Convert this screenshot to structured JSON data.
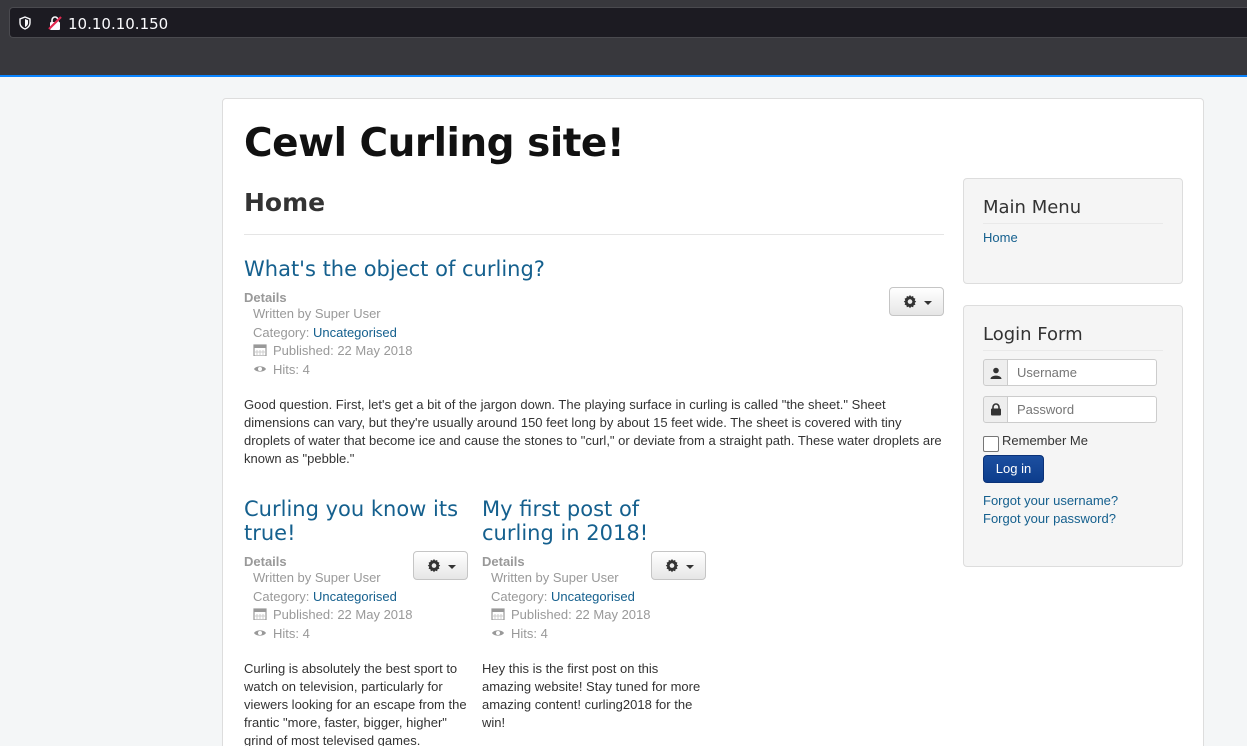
{
  "browser": {
    "url": "10.10.10.150"
  },
  "site": {
    "title": "Cewl Curling site!"
  },
  "main": {
    "page_heading": "Home",
    "details_label": "Details",
    "articles": [
      {
        "title": "What's the object of curling?",
        "author": "Written by Super User",
        "category_prefix": "Category: ",
        "category": "Uncategorised",
        "published": "Published: 22 May 2018",
        "hits": "Hits: 4",
        "body": "Good question. First, let's get a bit of the jargon down. The playing surface in curling is called \"the sheet.\" Sheet dimensions can vary, but they're usually around 150 feet long by about 15 feet wide. The sheet is covered with tiny droplets of water that become ice and cause the stones to \"curl,\" or deviate from a straight path. These water droplets are known as \"pebble.\""
      },
      {
        "title": "Curling you know its true!",
        "author": "Written by Super User",
        "category_prefix": "Category: ",
        "category": "Uncategorised",
        "published": "Published: 22 May 2018",
        "hits": "Hits: 4",
        "body": "Curling is absolutely the best sport to watch on television, particularly for viewers looking for an escape from the frantic \"more, faster, bigger, higher\" grind of most televised games."
      },
      {
        "title": "My first post of curling in 2018!",
        "author": "Written by Super User",
        "category_prefix": "Category: ",
        "category": "Uncategorised",
        "published": "Published: 22 May 2018",
        "hits": "Hits: 4",
        "body": "Hey this is the first post on this amazing website! Stay tuned for more amazing content! curling2018 for the win!"
      }
    ]
  },
  "sidebar": {
    "main_menu": {
      "title": "Main Menu",
      "items": [
        "Home"
      ]
    },
    "login": {
      "title": "Login Form",
      "username_placeholder": "Username",
      "password_placeholder": "Password",
      "remember_label": "Remember Me",
      "login_button": "Log in",
      "forgot_username": "Forgot your username?",
      "forgot_password": "Forgot your password?"
    }
  },
  "colors": {
    "link": "#15608e",
    "primary_button": "#0d3d8c",
    "browser_accent": "#0a84ff"
  }
}
